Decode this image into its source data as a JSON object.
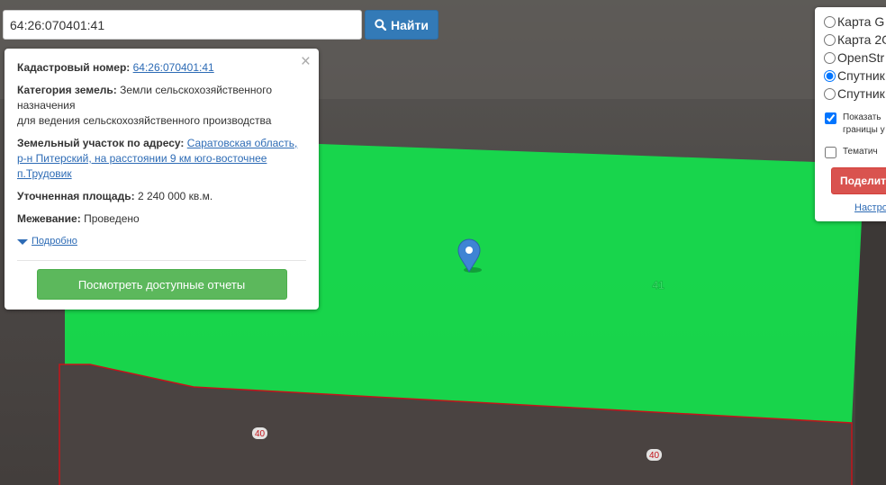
{
  "search": {
    "value": "64:26:070401:41",
    "button_label": "Найти"
  },
  "popup": {
    "cadastral_label": "Кадастровый номер:",
    "cadastral_value": "64:26:070401:41",
    "category_label": "Категория земель:",
    "category_value_line1": "Земли сельскохозяйственного",
    "category_value_line2": "назначения",
    "category_value_line3": "для ведения сельскохозяйственного производства",
    "address_label": "Земельный участок по адресу:",
    "address_value_line1": "Саратовская область,",
    "address_value_line2": "р-н Питерский, на расстоянии 9 км юго-восточнее",
    "address_value_line3": "п.Трудовик",
    "area_label": "Уточненная площадь:",
    "area_value": "2 240 000 кв.м.",
    "survey_label": "Межевание:",
    "survey_value": "Проведено",
    "more_label": "Подробно",
    "report_button": "Посмотреть доступные отчеты",
    "close_symbol": "×"
  },
  "layers": {
    "options": [
      {
        "label": "Карта G",
        "selected": false
      },
      {
        "label": "Карта 2G",
        "selected": false
      },
      {
        "label": "OpenStr",
        "selected": false
      },
      {
        "label": "Спутник",
        "selected": true
      },
      {
        "label": "Спутник",
        "selected": false
      }
    ],
    "show_borders_label_line1": "Показать",
    "show_borders_label_line2": "границы у",
    "show_borders_checked": true,
    "thematic_label": "Тематич",
    "thematic_checked": false,
    "share_button": "Поделит",
    "settings_link": "Настро"
  },
  "map": {
    "parcel_label_selected": "41",
    "parcel_label_1": "40",
    "parcel_label_2": "40",
    "highlight_color": "#14e04c",
    "border_color": "#c4141b",
    "marker_color": "#3f84d4"
  }
}
